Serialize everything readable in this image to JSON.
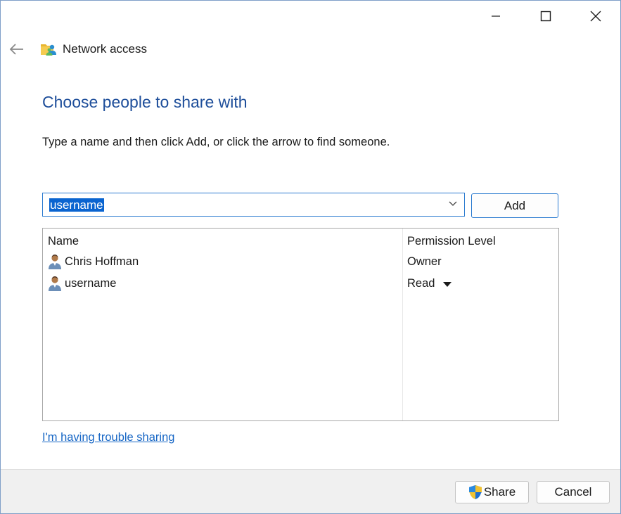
{
  "window": {
    "title": "Network access",
    "controls": {
      "minimize": "minimize-icon",
      "maximize": "maximize-icon",
      "close": "close-icon"
    },
    "back_icon": "back-arrow-icon",
    "title_icon": "network-folder-icon"
  },
  "main": {
    "heading": "Choose people to share with",
    "instructions": "Type a name and then click Add, or click the arrow to find someone.",
    "name_input": {
      "value": "username",
      "dropdown_icon": "chevron-down-icon"
    },
    "add_button": "Add"
  },
  "list": {
    "columns": {
      "name": "Name",
      "permission": "Permission Level"
    },
    "rows": [
      {
        "name": "Chris Hoffman",
        "permission": "Owner",
        "icon": "user-icon"
      },
      {
        "name": "username",
        "permission": "Read",
        "icon": "user-icon",
        "permission_dropdown": true
      }
    ]
  },
  "trouble_link": "I'm having trouble sharing",
  "footer": {
    "share_button": "Share",
    "share_icon": "uac-shield-icon",
    "cancel_button": "Cancel"
  },
  "colors": {
    "heading": "#1e4e9a",
    "link": "#1666c5",
    "selection": "#0a64d0",
    "focus_border": "#2b7bd0",
    "footer_bg": "#f0f0f0"
  }
}
